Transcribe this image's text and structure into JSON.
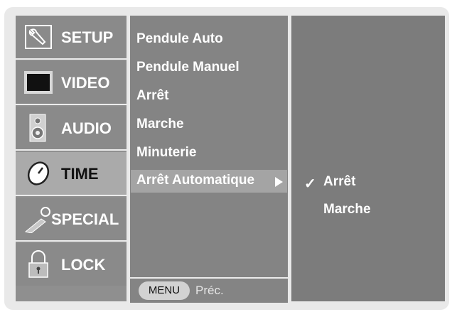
{
  "tabs": [
    {
      "label": "SETUP",
      "icon": "wrench-icon"
    },
    {
      "label": "VIDEO",
      "icon": "tv-screen-icon"
    },
    {
      "label": "AUDIO",
      "icon": "speaker-icon"
    },
    {
      "label": "TIME",
      "icon": "clock-icon",
      "active": true
    },
    {
      "label": "SPECIAL",
      "icon": "key-icon"
    },
    {
      "label": "LOCK",
      "icon": "padlock-icon"
    }
  ],
  "menu": {
    "items": [
      "Pendule Auto",
      "Pendule Manuel",
      "Arrêt",
      "Marche",
      "Minuterie"
    ],
    "selected": "Arrêt Automatique"
  },
  "footer": {
    "menu_button": "MENU",
    "back_label": "Préc."
  },
  "options": {
    "checkmark": "✓",
    "items": [
      "Arrêt",
      "Marche"
    ],
    "selected_index": 0
  },
  "colors": {
    "background": "#e9e9e9",
    "panel": "#848484",
    "highlight": "#a4a4a4",
    "text": "#ffffff"
  }
}
